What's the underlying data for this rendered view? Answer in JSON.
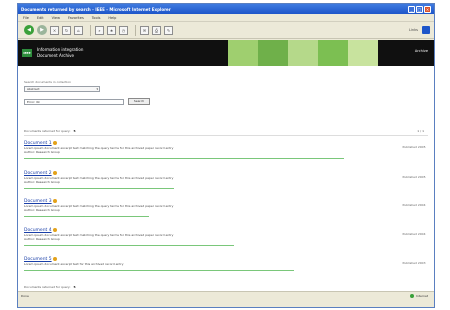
{
  "window": {
    "title": "Documents returned by search - IEEE - Microsoft Internet Explorer"
  },
  "menubar": {
    "items": [
      "File",
      "Edit",
      "View",
      "Favorites",
      "Tools",
      "Help"
    ]
  },
  "toolbar": {
    "links_label": "Links"
  },
  "banner": {
    "line1": "Information integration",
    "line2": "Document Archive",
    "right_label": "Archive"
  },
  "search": {
    "field_label": "Search documents in collection",
    "select_value": "Abstract",
    "input_value": "Error: 0k",
    "button_label": "Search"
  },
  "results": {
    "info_text": "Documents returned for query:",
    "info_count": "5",
    "info_page": "1 / 1",
    "items": [
      {
        "title": "Document 1",
        "line1": "Lorem ipsum document excerpt text matching the query terms for this archived paper record entry",
        "line2": "Author: Research Group",
        "date": "Published 2005"
      },
      {
        "title": "Document 2",
        "line1": "Lorem ipsum document excerpt text matching the query terms for this archived paper record entry",
        "line2": "Author: Research Group",
        "date": "Published 2005"
      },
      {
        "title": "Document 3",
        "line1": "Lorem ipsum document excerpt text matching the query terms for this archived paper record entry",
        "line2": "Author: Research Group",
        "date": "Published 2004"
      },
      {
        "title": "Document 4",
        "line1": "Lorem ipsum document excerpt text matching the query terms for this archived paper record entry",
        "line2": "Author: Research Group",
        "date": "Published 2004"
      },
      {
        "title": "Document 5",
        "line1": "Lorem ipsum document excerpt text for this archived record entry",
        "line2": "",
        "date": "Published 2003"
      }
    ]
  },
  "status": {
    "text": "Done",
    "zone": "Internet"
  },
  "colors": {
    "titlebar": "#1d55c9",
    "banner": "#101010",
    "link": "#1a3fa8",
    "bar": "#7ac77a"
  }
}
